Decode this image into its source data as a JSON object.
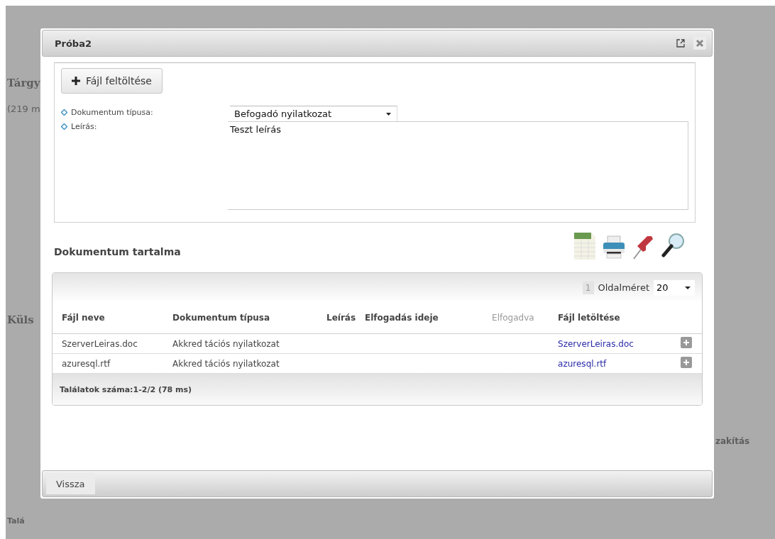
{
  "background_page": {
    "texts": [
      {
        "kind": "left",
        "text": "Tárgy"
      },
      {
        "kind": "left",
        "text": "(219 m"
      },
      {
        "kind": "left",
        "text": "Küls"
      },
      {
        "kind": "left",
        "text": "Talá"
      },
      {
        "kind": "right",
        "text": "zakítás"
      }
    ]
  },
  "dialog": {
    "title": "Próba2",
    "upload_button": "Fájl feltöltése",
    "fields": [
      {
        "kind": "select",
        "label": "Dokumentum típusa:",
        "value": "Befogadó nyilatkozat"
      },
      {
        "kind": "textarea",
        "label": "Leírás:",
        "value": "Teszt leírás"
      }
    ],
    "section_title": "Dokumentum tartalma",
    "grid": {
      "page": "1",
      "page_size_label": "Oldalméret",
      "page_size": "20",
      "columns": [
        {
          "label": "Fájl neve",
          "muted": false
        },
        {
          "label": "Dokumentum típusa",
          "muted": false
        },
        {
          "label": "Leírás",
          "muted": false
        },
        {
          "label": "Elfogadás ideje",
          "muted": false
        },
        {
          "label": "Elfogadva",
          "muted": true
        },
        {
          "label": "Fájl letöltése",
          "muted": false
        }
      ],
      "rows": [
        {
          "file": "SzerverLeiras.doc",
          "type": "Akkred tációs nyilatkozat",
          "download": "SzerverLeiras.doc"
        },
        {
          "file": "azuresql.rtf",
          "type": "Akkred tációs nyilatkozat",
          "download": "azuresql.rtf"
        }
      ],
      "footer": "Találatok száma:1-2/2 (78 ms)"
    },
    "back_button": "Vissza"
  }
}
